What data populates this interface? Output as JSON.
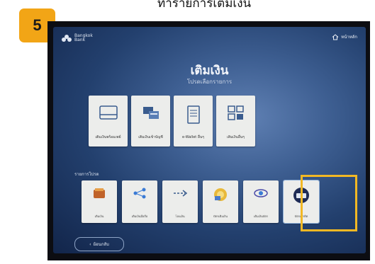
{
  "step": {
    "number": "5"
  },
  "header": {
    "text": "ทำรายการเติมเงิน"
  },
  "kiosk": {
    "logo_text": [
      "Bangkok",
      "Bank"
    ],
    "home_label": "หน้าหลัก",
    "title": "เติมเงิน",
    "subtitle": "โปรดเลือกรายการ",
    "cards": [
      {
        "label": "เติมเงินพร้อมเพย์",
        "icon": "card-icon"
      },
      {
        "label": "เติมเงินเข้าบัญชี",
        "icon": "bank-account-icon"
      },
      {
        "label": "e-Wallet อื่นๆ",
        "icon": "document-icon"
      },
      {
        "label": "เติมเงินอื่นๆ",
        "icon": "grid-icon"
      }
    ],
    "section_label": "รายการโปรด",
    "tiles": [
      {
        "label": "เติมเงิน",
        "icon": "wallet-icon"
      },
      {
        "label": "เติมเงินมือถือ",
        "icon": "share-network-icon"
      },
      {
        "label": "โอนเงิน",
        "icon": "transfer-arrow-icon"
      },
      {
        "label": "บัตรเติมเงิน",
        "icon": "coin-icon"
      },
      {
        "label": "เติมเงินบัตร",
        "icon": "satellite-icon"
      },
      {
        "label": "บัตรเครดิต",
        "icon": "credit-card-icon"
      }
    ],
    "back_label": "ย้อนกลับ"
  },
  "colors": {
    "badge": "#f2a516",
    "highlight": "#f2b824",
    "screen": "#2c4a7c"
  }
}
